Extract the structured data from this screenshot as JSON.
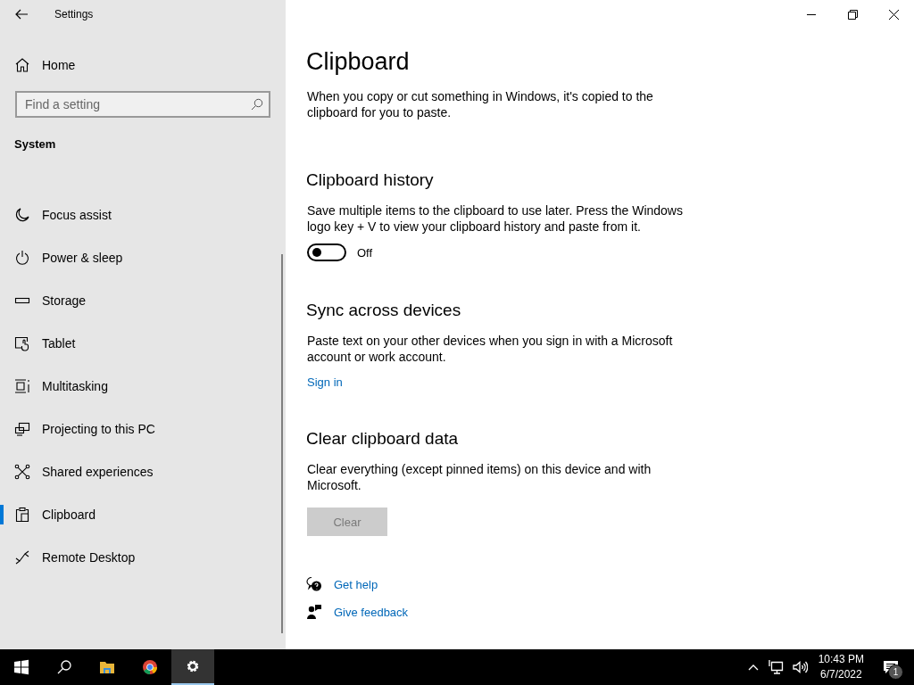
{
  "window": {
    "title": "Settings"
  },
  "sidebar": {
    "home": "Home",
    "search": {
      "placeholder": "Find a setting"
    },
    "section": "System",
    "items": [
      {
        "label": "Focus assist",
        "selected": false
      },
      {
        "label": "Power & sleep",
        "selected": false
      },
      {
        "label": "Storage",
        "selected": false
      },
      {
        "label": "Tablet",
        "selected": false
      },
      {
        "label": "Multitasking",
        "selected": false
      },
      {
        "label": "Projecting to this PC",
        "selected": false
      },
      {
        "label": "Shared experiences",
        "selected": false
      },
      {
        "label": "Clipboard",
        "selected": true
      },
      {
        "label": "Remote Desktop",
        "selected": false
      }
    ]
  },
  "main": {
    "title": "Clipboard",
    "intro": "When you copy or cut something in Windows, it's copied to the clipboard for you to paste.",
    "sections": [
      {
        "kind": "toggle",
        "heading": "Clipboard history",
        "text": "Save multiple items to the clipboard to use later. Press the Windows logo key + V to view your clipboard history and paste from it.",
        "toggle": {
          "on": false,
          "label": "Off"
        }
      },
      {
        "kind": "link",
        "heading": "Sync across devices",
        "text": "Paste text on your other devices when you sign in with a Microsoft account or work account.",
        "link": "Sign in"
      },
      {
        "kind": "button",
        "heading": "Clear clipboard data",
        "text": "Clear everything (except pinned items) on this device and with Microsoft.",
        "button": {
          "label": "Clear",
          "disabled": true
        }
      }
    ],
    "help_links": [
      {
        "label": "Get help"
      },
      {
        "label": "Give feedback"
      }
    ]
  },
  "taskbar": {
    "buttons": [
      {
        "selected": false
      },
      {
        "selected": false
      },
      {
        "selected": false
      },
      {
        "selected": false
      },
      {
        "selected": true
      }
    ],
    "tray": {
      "time": "10:43 PM",
      "date": "6/7/2022",
      "notifications": "1"
    }
  }
}
